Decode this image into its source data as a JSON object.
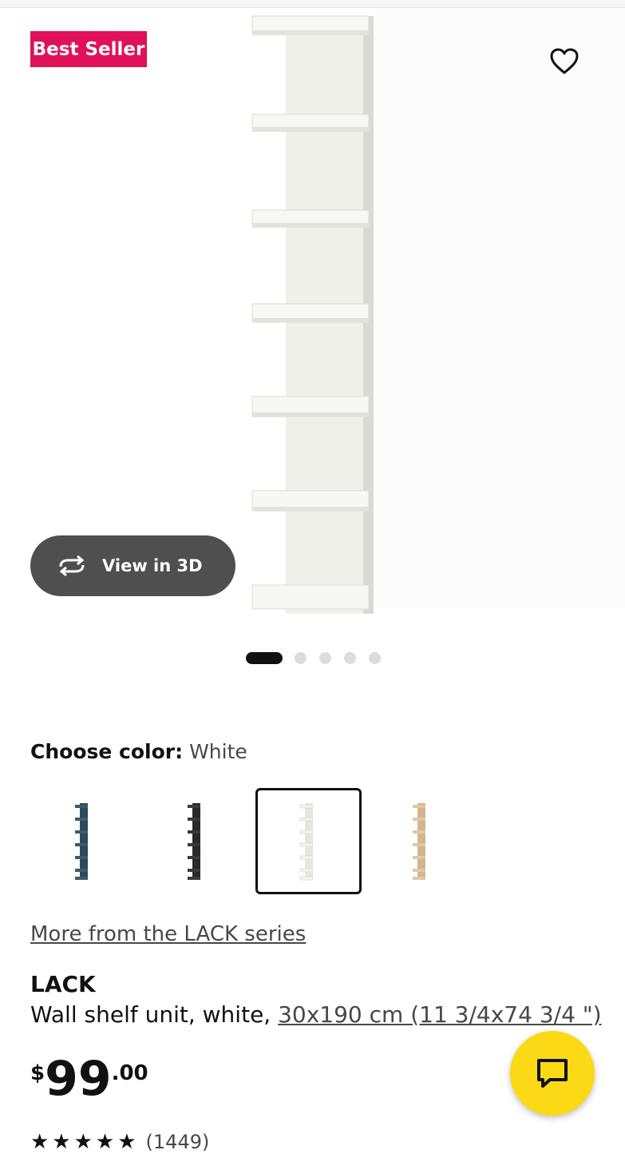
{
  "badge": {
    "label": "Best Seller",
    "color": "#e0105a"
  },
  "gallery": {
    "favorite_icon": "heart-outline-icon",
    "view3d_label": "View in 3D",
    "view3d_icon": "rotate-3d-icon",
    "dots_total": 5,
    "dots_active": 1
  },
  "color": {
    "label": "Choose color:",
    "value": "White",
    "options": [
      {
        "name": "Blue",
        "swatch": "#2d4a56",
        "selected": false
      },
      {
        "name": "Black-brown",
        "swatch": "#2a2a2a",
        "selected": false
      },
      {
        "name": "White",
        "swatch": "#ecece6",
        "selected": true
      },
      {
        "name": "Oak effect",
        "swatch": "#d8bf9b",
        "selected": false
      }
    ]
  },
  "series_link": "More from the LACK series",
  "product": {
    "name": "LACK",
    "description": "Wall shelf unit, white, ",
    "dimensions": "30x190 cm (11 3/4x74 3/4 \")"
  },
  "price": {
    "currency": "$",
    "integer": "99",
    "decimal": ".00"
  },
  "rating": {
    "stars": "★★★★★",
    "count": "(1449)"
  },
  "chat": {
    "icon": "chat-bubble-icon",
    "color": "#fbd914"
  }
}
